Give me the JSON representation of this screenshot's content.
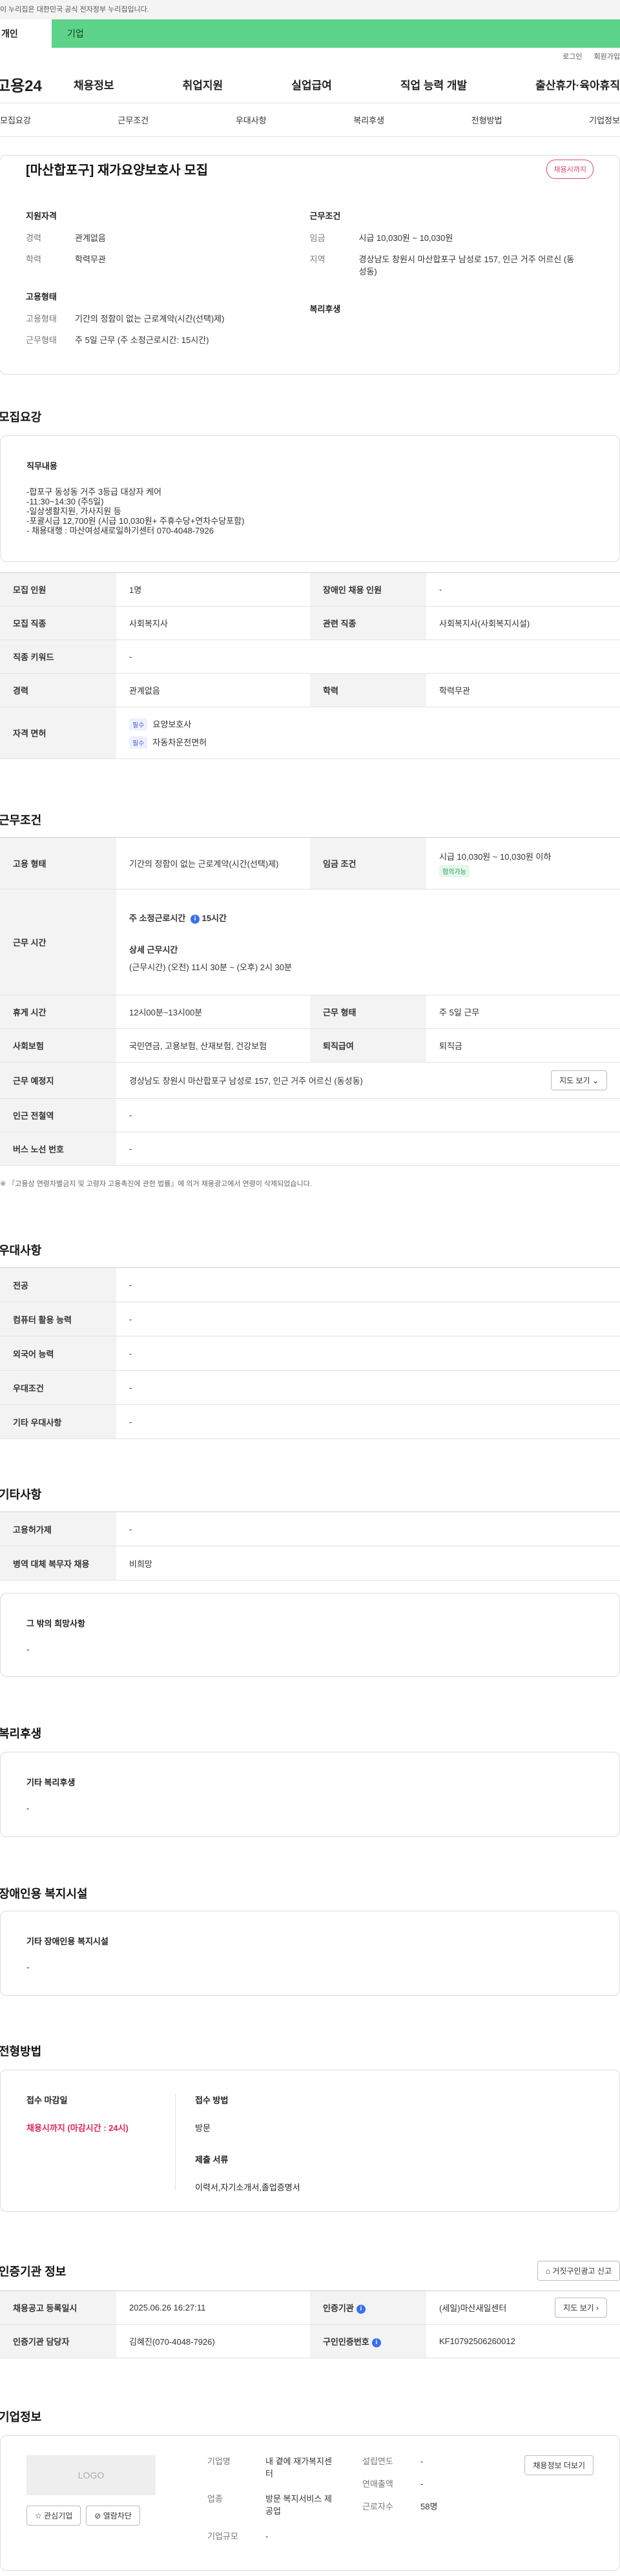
{
  "header": {
    "gov_banner": "이 누리집은 대한민국 공식 전자정부 누리집입니다.",
    "tab_person": "개인",
    "tab_corp": "기업",
    "login": "로그인",
    "signup": "회원가입",
    "logo": "고용24",
    "menu": [
      "채용정보",
      "취업지원",
      "실업급여",
      "직업 능력 개발",
      "출산휴가·육아휴직"
    ]
  },
  "anchor_nav": [
    "모집요강",
    "근무조건",
    "우대사항",
    "복리후생",
    "전형방법",
    "기업정보"
  ],
  "summary": {
    "title": "[마산합포구] 재가요양보호사 모집",
    "status": "채용시까지",
    "qual_heading": "지원자격",
    "career_k": "경력",
    "career_v": "관계없음",
    "edu_k": "학력",
    "edu_v": "학력무관",
    "emp_heading": "고용형태",
    "emptype_k": "고용형태",
    "emptype_v": "기간의 정함이 없는 근로계약(시간(선택)제)",
    "worktype_k": "근무형태",
    "worktype_v": "주 5일 근무 (주 소정근로시간: 15시간)",
    "cond_heading": "근무조건",
    "wage_k": "임금",
    "wage_v": "시급 10,030원 ~ 10,030원",
    "region_k": "지역",
    "region_v": "경상남도 창원시 마산합포구 남성로 157, 인근 거주 어르신 (동성동)",
    "welfare_heading": "복리후생"
  },
  "recruit": {
    "section": "모집요강",
    "duty_heading": "직무내용",
    "duty_text": "-합포구 동성동 거주 3등급 대상자 케어\n-11:30~14:30 (주5일)\n-일상생활지원, 가사지원 등\n-포괄시급 12,700원 (시급 10,030원+ 주휴수당+연차수당포함)\n- 채용대행 : 마산여성새로일하기센터  070-4048-7926",
    "rows": {
      "count_k": "모집 인원",
      "count_v": "1명",
      "disabled_k": "장애인 채용 인원",
      "disabled_v": "-",
      "job_k": "모집 직종",
      "job_v": "사회복지사",
      "related_k": "관련 직종",
      "related_v": "사회복지사(사회복지시설)",
      "keyword_k": "직종 키워드",
      "keyword_v": "-",
      "career_k": "경력",
      "career_v": "관계없음",
      "edu_k": "학력",
      "edu_v": "학력무관",
      "license_k": "자격 면허",
      "license_tag": "필수",
      "license_1": "요양보호사",
      "license_2": "자동차운전면허"
    }
  },
  "conditions": {
    "section": "근무조건",
    "emptype_k": "고용 형태",
    "emptype_v": "기간의 정함이 없는 근로계약(시간(선택)제)",
    "wage_k": "임금 조건",
    "wage_v": "시급 10,030원 ~ 10,030원 이하",
    "wage_tag": "협의가능",
    "hours_k": "근무 시간",
    "hours_label": "주 소정근로시간",
    "hours_value": "15시간",
    "detail_label": "상세 근무시간",
    "detail_value": "(근무시간) (오전) 11시 30분 ~ (오후) 2시 30분",
    "break_k": "휴게 시간",
    "break_v": "12시00분~13시00분",
    "form_k": "근무 형태",
    "form_v": "주 5일 근무",
    "insurance_k": "사회보험",
    "insurance_v": "국민연금, 고용보험, 산재보험, 건강보험",
    "severance_k": "퇴직급여",
    "severance_v": "퇴직금",
    "place_k": "근무 예정지",
    "place_v": "경상남도 창원시 마산합포구 남성로 157, 인근 거주 어르신 (동성동)",
    "map_btn": "지도 보기",
    "subway_k": "인근 전철역",
    "subway_v": "-",
    "bus_k": "버스 노선 번호",
    "bus_v": "-",
    "note": "※ 『고용상 연령차별금지 및 고령자 고용촉진에 관한 법률』에 의거 채용광고에서 연령이 삭제되었습니다."
  },
  "preferences": {
    "section": "우대사항",
    "rows": [
      {
        "k": "전공",
        "v": "-"
      },
      {
        "k": "컴퓨터 활용 능력",
        "v": "-"
      },
      {
        "k": "외국어 능력",
        "v": "-"
      },
      {
        "k": "우대조건",
        "v": "-"
      },
      {
        "k": "기타 우대사항",
        "v": "-"
      }
    ]
  },
  "etc": {
    "section": "기타사항",
    "rows": [
      {
        "k": "고용허가제",
        "v": "-"
      },
      {
        "k": "병역 대체 복무자 채용",
        "v": "비희망"
      }
    ],
    "other_heading": "그 밖의 희망사항",
    "other_value": "-"
  },
  "welfare": {
    "section": "복리후생",
    "heading": "기타 복리후생",
    "value": "-"
  },
  "disability": {
    "section": "장애인용 복지시설",
    "heading": "기타 장애인용 복지시설",
    "value": "-"
  },
  "selection": {
    "section": "전형방법",
    "deadline_heading": "접수 마감일",
    "deadline_value": "채용시까지 (마감시간 : 24시)",
    "method_heading": "접수 방법",
    "method_value": "방문",
    "docs_heading": "제출 서류",
    "docs_value": "이력서,자기소개서,졸업증명서"
  },
  "agency": {
    "section": "인증기관 정보",
    "report_btn": "거짓구인광고 신고",
    "reg_k": "채용공고 등록일시",
    "reg_v": "2025.06.26 16:27:11",
    "org_k": "인증기관",
    "org_v": "(세일)마산새일센터",
    "org_btn": "지도 보기",
    "manager_k": "인증기관 담당자",
    "manager_v": "김혜진(070-4048-7926)",
    "cert_k": "구인인증번호",
    "cert_v": "KF10792506260012"
  },
  "company": {
    "section": "기업정보",
    "logo": "LOGO",
    "fav_btn": "관심기업",
    "block_btn": "열람차단",
    "name_k": "기업명",
    "name_v": "내 곁에 재가복지센터",
    "industry_k": "업종",
    "industry_v": "방문 복지서비스 제공업",
    "size_k": "기업규모",
    "size_v": "-",
    "founded_k": "설립연도",
    "founded_v": "-",
    "revenue_k": "연매출액",
    "revenue_v": "-",
    "staff_k": "근로자수",
    "staff_v": "58명",
    "jobs_btn": "채용정보 더보기"
  }
}
